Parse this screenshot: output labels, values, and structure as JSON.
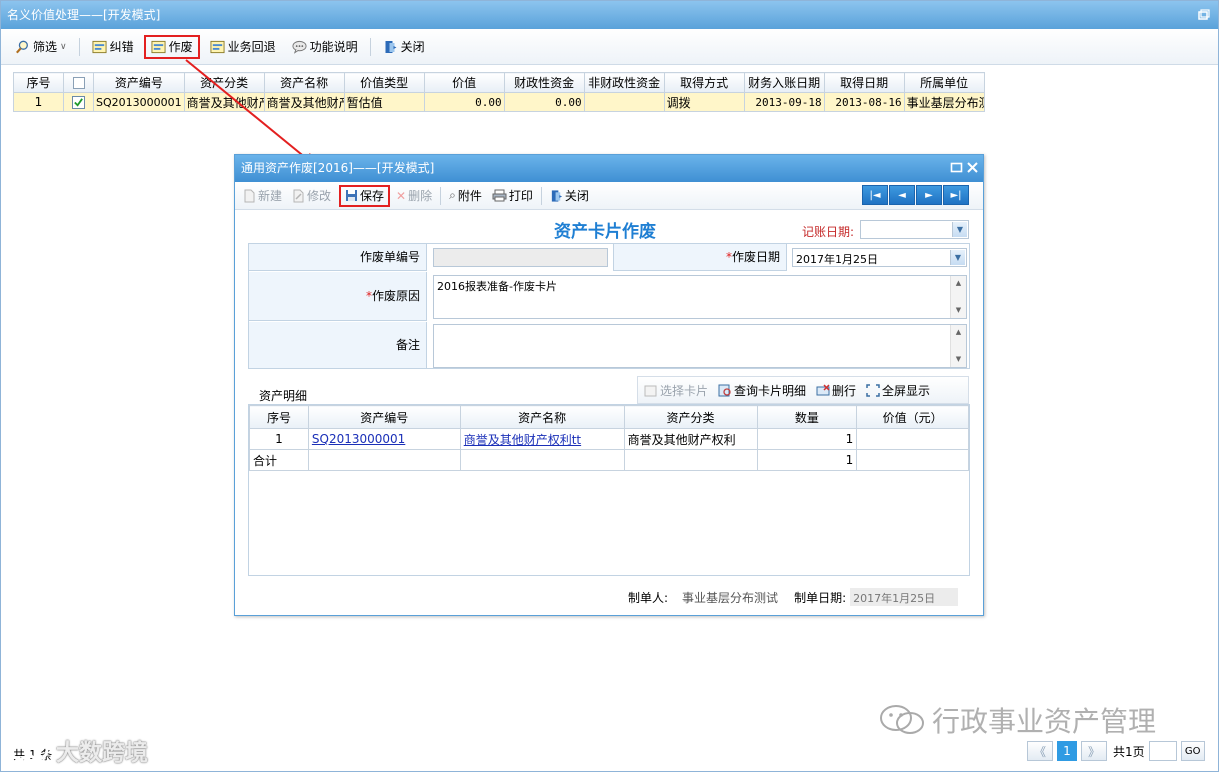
{
  "main_window": {
    "title": "名义价值处理——[开发模式]",
    "toolbar": {
      "filter": "筛选",
      "correct": "纠错",
      "void": "作废",
      "rollback": "业务回退",
      "help": "功能说明",
      "close": "关闭"
    },
    "grid": {
      "headers": [
        "序号",
        "",
        "资产编号",
        "资产分类",
        "资产名称",
        "价值类型",
        "价值",
        "财政性资金",
        "非财政性资金",
        "取得方式",
        "财务入账日期",
        "取得日期",
        "所属单位"
      ],
      "rows": [
        {
          "no": "1",
          "checked": true,
          "code": "SQ2013000001",
          "category": "商誉及其他财产",
          "name": "商誉及其他财产",
          "value_type": "暂估值",
          "value": "0.00",
          "fiscal": "0.00",
          "non_fiscal": "",
          "acquire_method": "调拨",
          "post_date": "2013-09-18",
          "acquire_date": "2013-08-16",
          "unit": "事业基层分布测试"
        }
      ]
    },
    "footer_count": "共 1 条",
    "pager": {
      "first": "《",
      "current": "1",
      "last": "》",
      "total_pages": "共1页",
      "go": "GO"
    }
  },
  "dialog": {
    "title": "通用资产作废[2016]——[开发模式]",
    "toolbar": {
      "new": "新建",
      "edit": "修改",
      "save": "保存",
      "delete": "删除",
      "attach": "附件",
      "print": "打印",
      "close": "关闭"
    },
    "nav": {
      "first": "|◄",
      "prev": "◄",
      "next": "►",
      "last": "►|"
    },
    "card_title": "资产卡片作废",
    "post_date_label": "记账日期:",
    "form": {
      "doc_no_label": "作废单编号",
      "doc_no_value": "",
      "void_date_label": "作废日期",
      "void_date_value": "2017年1月25日",
      "reason_label": "作废原因",
      "reason_value": "2016报表准备-作废卡片",
      "remark_label": "备注",
      "remark_value": "",
      "required_mark": "*"
    },
    "detail": {
      "section_label": "资产明细",
      "toolbar": {
        "select_card": "选择卡片",
        "query_card": "查询卡片明细",
        "delete_row": "删行",
        "fullscreen": "全屏显示"
      },
      "headers": [
        "序号",
        "资产编号",
        "资产名称",
        "资产分类",
        "数量",
        "价值（元）"
      ],
      "rows": [
        {
          "no": "1",
          "code": "SQ2013000001",
          "name": "商誉及其他财产权利tt",
          "category": "商誉及其他财产权利",
          "qty": "1",
          "value": ""
        }
      ],
      "total": {
        "label": "合计",
        "qty": "1",
        "value": ""
      }
    },
    "maker_label": "制单人:",
    "maker_value": "事业基层分布测试",
    "maker_date_label": "制单日期:",
    "maker_date_value": "2017年1月25日"
  },
  "watermarks": {
    "right": "行政事业资产管理",
    "left": "大数跨境"
  },
  "colors": {
    "highlight_red": "#e32020",
    "title_blue": "#1f7fd3",
    "link_blue": "#1b30b8"
  }
}
